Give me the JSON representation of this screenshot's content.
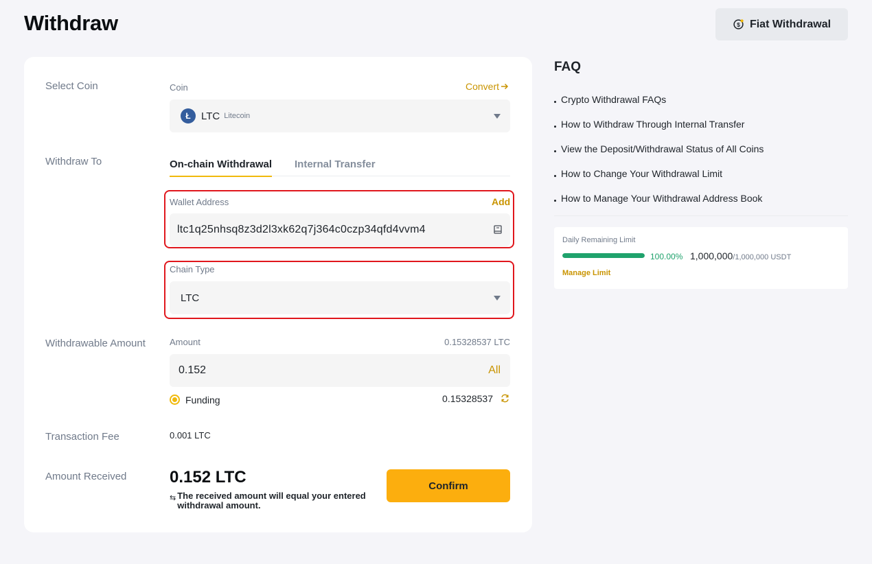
{
  "header": {
    "title": "Withdraw",
    "fiat_button": "Fiat Withdrawal"
  },
  "form": {
    "select_coin": {
      "row_label": "Select Coin",
      "field_label": "Coin",
      "convert_link": "Convert",
      "coin_symbol": "LTC",
      "coin_name": "Litecoin",
      "coin_logo_glyph": "Ł"
    },
    "withdraw_to": {
      "row_label": "Withdraw To",
      "tabs": [
        "On-chain Withdrawal",
        "Internal Transfer"
      ],
      "active_tab": "On-chain Withdrawal"
    },
    "wallet_address": {
      "label": "Wallet Address",
      "add_link": "Add",
      "value": "ltc1q25nhsq8z3d2l3xk62q7j364c0czp34qfd4vvm4"
    },
    "chain_type": {
      "label": "Chain Type",
      "value": "LTC"
    },
    "withdrawable_amount": {
      "row_label": "Withdrawable Amount",
      "field_label": "Amount",
      "available": "0.15328537 LTC",
      "value": "0.152",
      "all_link": "All",
      "wallet_label": "Funding",
      "wallet_balance": "0.15328537"
    },
    "transaction_fee": {
      "row_label": "Transaction Fee",
      "value": "0.001 LTC"
    },
    "amount_received": {
      "row_label": "Amount Received",
      "value": "0.152 LTC",
      "note": "The received amount will equal your entered withdrawal amount."
    },
    "confirm_button": "Confirm"
  },
  "faq": {
    "title": "FAQ",
    "items": [
      "Crypto Withdrawal FAQs",
      "How to Withdraw Through Internal Transfer",
      "View the Deposit/Withdrawal Status of All Coins",
      "How to Change Your Withdrawal Limit",
      "How to Manage Your Withdrawal Address Book"
    ]
  },
  "limit": {
    "title": "Daily Remaining Limit",
    "percent": "100.00%",
    "fill_fraction": 1.0,
    "remaining": "1,000,000",
    "total": "/1,000,000 USDT",
    "manage_link": "Manage Limit"
  },
  "colors": {
    "accent": "#fcae0e",
    "link": "#c99400",
    "highlight": "#e0161c",
    "success": "#1fa26c"
  }
}
